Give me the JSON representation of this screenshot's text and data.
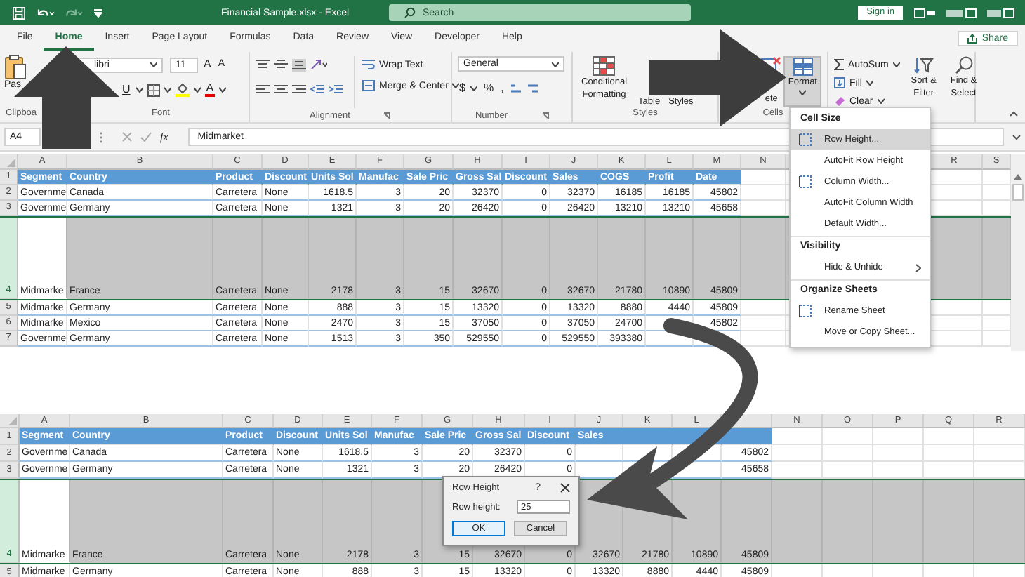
{
  "title_bar": {
    "title": "Financial Sample.xlsx - Excel",
    "search": {
      "placeholder": "Search"
    },
    "sign_in": "Sign in"
  },
  "tabs": [
    {
      "label": "File",
      "selected": false
    },
    {
      "label": "Home",
      "selected": true
    },
    {
      "label": "Insert",
      "selected": false
    },
    {
      "label": "Page Layout",
      "selected": false
    },
    {
      "label": "Formulas",
      "selected": false
    },
    {
      "label": "Data",
      "selected": false
    },
    {
      "label": "Review",
      "selected": false
    },
    {
      "label": "View",
      "selected": false
    },
    {
      "label": "Developer",
      "selected": false
    },
    {
      "label": "Help",
      "selected": false
    }
  ],
  "share": "Share",
  "ribbon": {
    "clipboard": {
      "paste": "Pas",
      "label": "Clipboa"
    },
    "font": {
      "name": "libri",
      "size": "11",
      "grow": "A",
      "shrink": "A",
      "underline": "U",
      "color_letter": "A",
      "label": "Font"
    },
    "alignment": {
      "wrap": "Wrap Text",
      "merge": "Merge & Center",
      "label": "Alignment"
    },
    "number": {
      "format": "General",
      "currency": "$",
      "percent": "%",
      "comma": ",",
      "label": "Number"
    },
    "styles": {
      "conditional": [
        "Conditional",
        "Formatting"
      ],
      "table": "Table",
      "cell_styles": "Styles",
      "label": "Styles"
    },
    "cells": {
      "delete": "ete",
      "format": {
        "label": "Format",
        "selected": true
      },
      "label": "Cells"
    },
    "editing": {
      "autosum": "AutoSum",
      "fill": "Fill",
      "clear": "Clear",
      "sort": [
        "Sort &",
        "Filter"
      ],
      "find": [
        "Find &",
        "Select"
      ]
    }
  },
  "formula_bar": {
    "name_box": "A4",
    "fx": "fx",
    "value": "Midmarket"
  },
  "sheets": [
    {
      "columns": [
        "A",
        "B",
        "C",
        "D",
        "E",
        "F",
        "G",
        "H",
        "I",
        "J",
        "K",
        "L",
        "M",
        "N",
        null,
        null,
        null,
        "R",
        "S"
      ],
      "rows": [
        {
          "num": "1",
          "kind": "header",
          "selected": false,
          "tall": false,
          "cells": [
            "Segment",
            "Country",
            "Product",
            "Discount",
            "Units Sol",
            "Manufac",
            "Sale Pric",
            "Gross Sal",
            "Discount",
            "Sales",
            "COGS",
            "Profit",
            "Date"
          ]
        },
        {
          "num": "2",
          "kind": "data",
          "selected": false,
          "tall": false,
          "cells": [
            "Governme",
            "Canada",
            "Carretera",
            "None",
            "1618.5",
            "3",
            "20",
            "32370",
            "0",
            "32370",
            "16185",
            "16185",
            "45802"
          ]
        },
        {
          "num": "3",
          "kind": "data",
          "selected": false,
          "tall": false,
          "cells": [
            "Governme",
            "Germany",
            "Carretera",
            "None",
            "1321",
            "3",
            "20",
            "26420",
            "0",
            "26420",
            "13210",
            "13210",
            "45658"
          ]
        },
        {
          "num": "4",
          "kind": "data",
          "selected": true,
          "tall": true,
          "cells": [
            "Midmarke",
            "France",
            "Carretera",
            "None",
            "2178",
            "3",
            "15",
            "32670",
            "0",
            "32670",
            "21780",
            "10890",
            "45809"
          ]
        },
        {
          "num": "5",
          "kind": "data",
          "selected": false,
          "tall": false,
          "cells": [
            "Midmarke",
            "Germany",
            "Carretera",
            "None",
            "888",
            "3",
            "15",
            "13320",
            "0",
            "13320",
            "8880",
            "4440",
            "45809"
          ]
        },
        {
          "num": "6",
          "kind": "data",
          "selected": false,
          "tall": false,
          "cells": [
            "Midmarke",
            "Mexico",
            "Carretera",
            "None",
            "2470",
            "3",
            "15",
            "37050",
            "0",
            "37050",
            "24700",
            null,
            "45802"
          ]
        },
        {
          "num": "7",
          "kind": "data",
          "selected": false,
          "tall": false,
          "cells": [
            "Governme",
            "Germany",
            "Carretera",
            "None",
            "1513",
            "3",
            "350",
            "529550",
            "0",
            "529550",
            "393380",
            null,
            null
          ]
        }
      ]
    },
    {
      "columns": [
        "A",
        "B",
        "C",
        "D",
        "E",
        "F",
        "G",
        "H",
        "I",
        "J",
        "K",
        "L",
        null,
        "N",
        "O",
        "P",
        "Q",
        "R"
      ],
      "rows": [
        {
          "num": "1",
          "kind": "header",
          "selected": false,
          "tall": false,
          "cells": [
            "Segment",
            "Country",
            "Product",
            "Discount",
            "Units Sol",
            "Manufac",
            "Sale Pric",
            "Gross Sal",
            "Discount",
            "Sales",
            null,
            null,
            null
          ]
        },
        {
          "num": "2",
          "kind": "data",
          "selected": false,
          "tall": false,
          "cells": [
            "Governme",
            "Canada",
            "Carretera",
            "None",
            "1618.5",
            "3",
            "20",
            "32370",
            "0",
            null,
            null,
            null,
            "45802"
          ]
        },
        {
          "num": "3",
          "kind": "data",
          "selected": false,
          "tall": false,
          "cells": [
            "Governme",
            "Germany",
            "Carretera",
            "None",
            "1321",
            "3",
            "20",
            "26420",
            "0",
            null,
            null,
            null,
            "45658"
          ]
        },
        {
          "num": "4",
          "kind": "data",
          "selected": true,
          "tall": true,
          "cells": [
            "Midmarke",
            "France",
            "Carretera",
            "None",
            "2178",
            "3",
            "15",
            "32670",
            "0",
            "32670",
            "21780",
            "10890",
            "45809"
          ]
        },
        {
          "num": "5",
          "kind": "data",
          "selected": false,
          "tall": false,
          "cells": [
            "Midmarke",
            "Germany",
            "Carretera",
            "None",
            "888",
            "3",
            "15",
            "13320",
            "0",
            "13320",
            "8880",
            "4440",
            "45809"
          ]
        }
      ]
    }
  ],
  "format_menu": {
    "items": [
      {
        "kind": "heading",
        "label": "Cell Size"
      },
      {
        "kind": "item",
        "label": "Row Height...",
        "selected": true,
        "has_icon": true,
        "submenu": false
      },
      {
        "kind": "item",
        "label": "AutoFit Row Height",
        "selected": false,
        "has_icon": false,
        "submenu": false
      },
      {
        "kind": "item",
        "label": "Column Width...",
        "selected": false,
        "has_icon": true,
        "submenu": false
      },
      {
        "kind": "item",
        "label": "AutoFit Column Width",
        "selected": false,
        "has_icon": false,
        "submenu": false
      },
      {
        "kind": "item",
        "label": "Default Width...",
        "selected": false,
        "has_icon": false,
        "submenu": false
      },
      {
        "kind": "heading",
        "label": "Visibility"
      },
      {
        "kind": "item",
        "label": "Hide & Unhide",
        "selected": false,
        "has_icon": false,
        "submenu": true
      },
      {
        "kind": "heading",
        "label": "Organize Sheets"
      },
      {
        "kind": "item",
        "label": "Rename Sheet",
        "selected": false,
        "has_icon": true,
        "submenu": false
      },
      {
        "kind": "item",
        "label": "Move or Copy Sheet...",
        "selected": false,
        "has_icon": false,
        "submenu": false
      }
    ]
  },
  "dialog": {
    "title": "Row Height",
    "help": "?",
    "label": "Row height:",
    "value": "25",
    "buttons": [
      {
        "label": "OK",
        "selected": true
      },
      {
        "label": "Cancel",
        "selected": false
      }
    ]
  }
}
